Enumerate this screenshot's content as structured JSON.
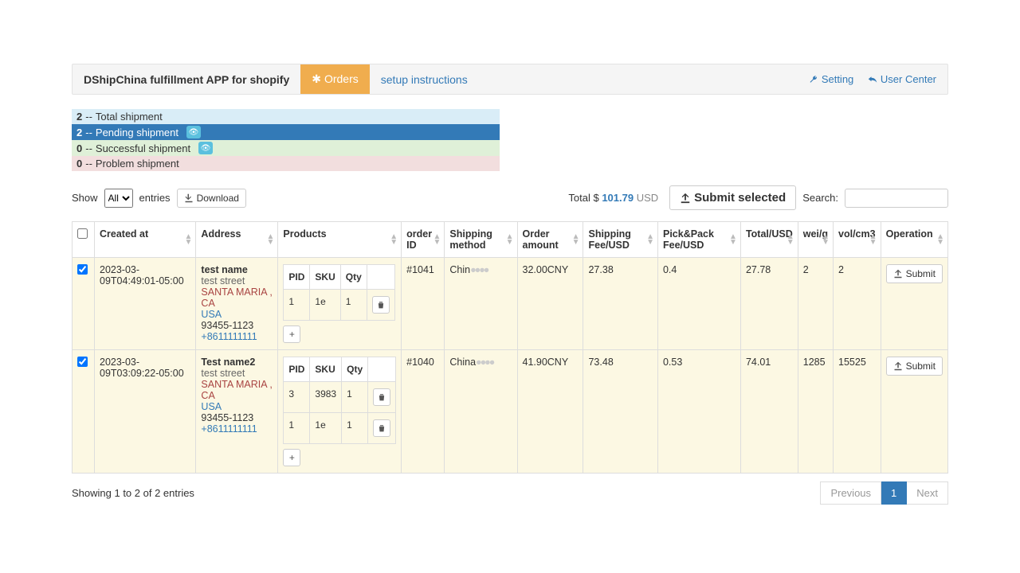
{
  "app": {
    "title": "DShipChina fulfillment APP for shopify"
  },
  "tabs": {
    "orders": "Orders",
    "setup": "setup instructions"
  },
  "topright": {
    "setting": "Setting",
    "user_center": "User Center"
  },
  "status": {
    "total": {
      "count": "2",
      "label": "Total shipment"
    },
    "pending": {
      "count": "2",
      "label": "Pending shipment"
    },
    "success": {
      "count": "0",
      "label": "Successful shipment"
    },
    "problem": {
      "count": "0",
      "label": "Problem shipment"
    }
  },
  "controls": {
    "show": "Show",
    "entries": "entries",
    "length_option": "All",
    "download": "Download",
    "total_prefix": "Total $ ",
    "total_amount": "101.79",
    "total_currency": " USD",
    "submit_selected": "Submit selected",
    "search_label": "Search:"
  },
  "columns": {
    "created": "Created at",
    "address": "Address",
    "products": "Products",
    "order_id": "order ID",
    "shipping_method": "Shipping method",
    "order_amount": "Order amount",
    "shipping_fee": "Shipping Fee/USD",
    "pickpack_fee": "Pick&Pack Fee/USD",
    "total": "Total/USD",
    "wei": "wei/g",
    "vol": "vol/cm3",
    "operation": "Operation"
  },
  "nested_cols": {
    "pid": "PID",
    "sku": "SKU",
    "qty": "Qty"
  },
  "rows": [
    {
      "checked": true,
      "created": "2023-03-09T04:49:01-05:00",
      "address": {
        "name": "test name",
        "street": "test street",
        "loc": "SANTA MARIA , CA",
        "country": "USA",
        "zip": "93455-1123",
        "phone": "+8611111111"
      },
      "products": [
        {
          "pid": "1",
          "sku": "1e",
          "qty": "1"
        }
      ],
      "order_id": "#1041",
      "shipping_method": "Chin",
      "order_amount": "32.00CNY",
      "shipping_fee": "27.38",
      "pickpack_fee": "0.4",
      "total": "27.78",
      "wei": "2",
      "vol": "2",
      "op": "Submit"
    },
    {
      "checked": true,
      "created": "2023-03-09T03:09:22-05:00",
      "address": {
        "name": "Test name2",
        "street": "test street",
        "loc": "SANTA MARIA , CA",
        "country": "USA",
        "zip": "93455-1123",
        "phone": "+8611111111"
      },
      "products": [
        {
          "pid": "3",
          "sku": "3983",
          "qty": "1"
        },
        {
          "pid": "1",
          "sku": "1e",
          "qty": "1"
        }
      ],
      "order_id": "#1040",
      "shipping_method": "China",
      "order_amount": "41.90CNY",
      "shipping_fee": "73.48",
      "pickpack_fee": "0.53",
      "total": "74.01",
      "wei": "1285",
      "vol": "15525",
      "op": "Submit"
    }
  ],
  "footer": {
    "info": "Showing 1 to 2 of 2 entries",
    "prev": "Previous",
    "page": "1",
    "next": "Next"
  }
}
